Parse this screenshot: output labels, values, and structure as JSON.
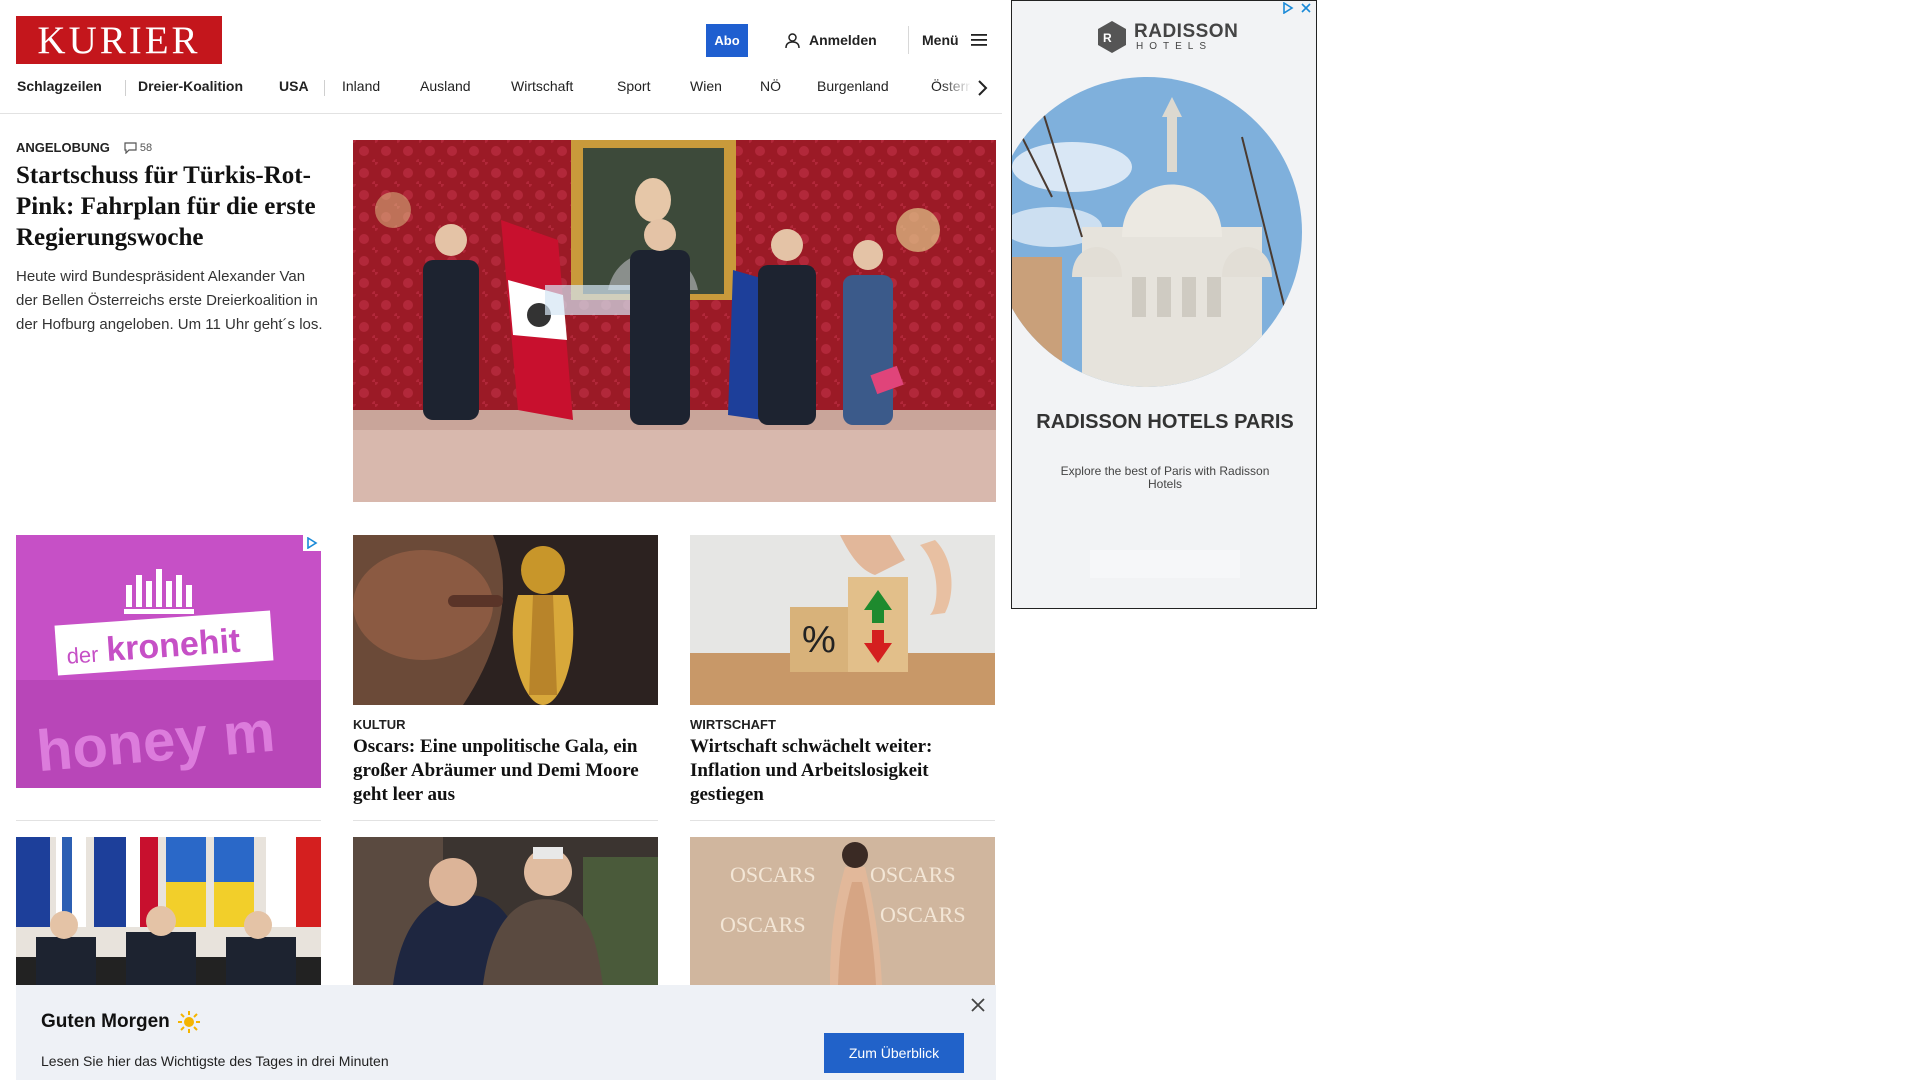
{
  "header": {
    "logo": "KURIER",
    "abo_label": "Abo",
    "login_label": "Anmelden",
    "menu_label": "Menü"
  },
  "nav": {
    "items": [
      {
        "label": "Schlagzeilen"
      },
      {
        "label": "Dreier-Koalition"
      },
      {
        "label": "USA"
      },
      {
        "label": "Inland"
      },
      {
        "label": "Ausland"
      },
      {
        "label": "Wirtschaft"
      },
      {
        "label": "Sport"
      },
      {
        "label": "Wien"
      },
      {
        "label": "NÖ"
      },
      {
        "label": "Burgenland"
      },
      {
        "label": "Österre"
      }
    ]
  },
  "lead": {
    "kicker": "ANGELOBUNG",
    "comments": "58",
    "title": "Startschuss für Türkis-Rot-Pink: Fahrplan für die erste Regierungswoche",
    "text": "Heute wird Bundespräsident Alexander Van der Bellen Österreichs erste Dreierkoalition in der Hofburg angeloben. Um 11 Uhr geht´s los."
  },
  "cards": [
    {
      "kicker": "KULTUR",
      "title": "Oscars: Eine unpolitische Gala, ein großer Abräumer und Demi Moore geht leer aus"
    },
    {
      "kicker": "WIRTSCHAFT",
      "title": "Wirtschaft schwächelt weiter: Inflation und Arbeitslosigkeit gestiegen"
    }
  ],
  "ad_left": {
    "brand_prefix": "der",
    "brand": "kronehit",
    "bg_text": "honey m"
  },
  "ad_right": {
    "logo": "RADISSON",
    "logo_sub": "HOTELS",
    "title": "RADISSON HOTELS PARIS",
    "subtitle": "Explore the best of Paris with Radisson Hotels"
  },
  "banner": {
    "title": "Guten Morgen",
    "text": "Lesen Sie hier das Wichtigste des Tages in drei Minuten",
    "button": "Zum Überblick"
  },
  "colors": {
    "brand_red": "#c4161c",
    "accent_blue": "#1f5fd0",
    "banner_bg": "#eef1f6"
  }
}
